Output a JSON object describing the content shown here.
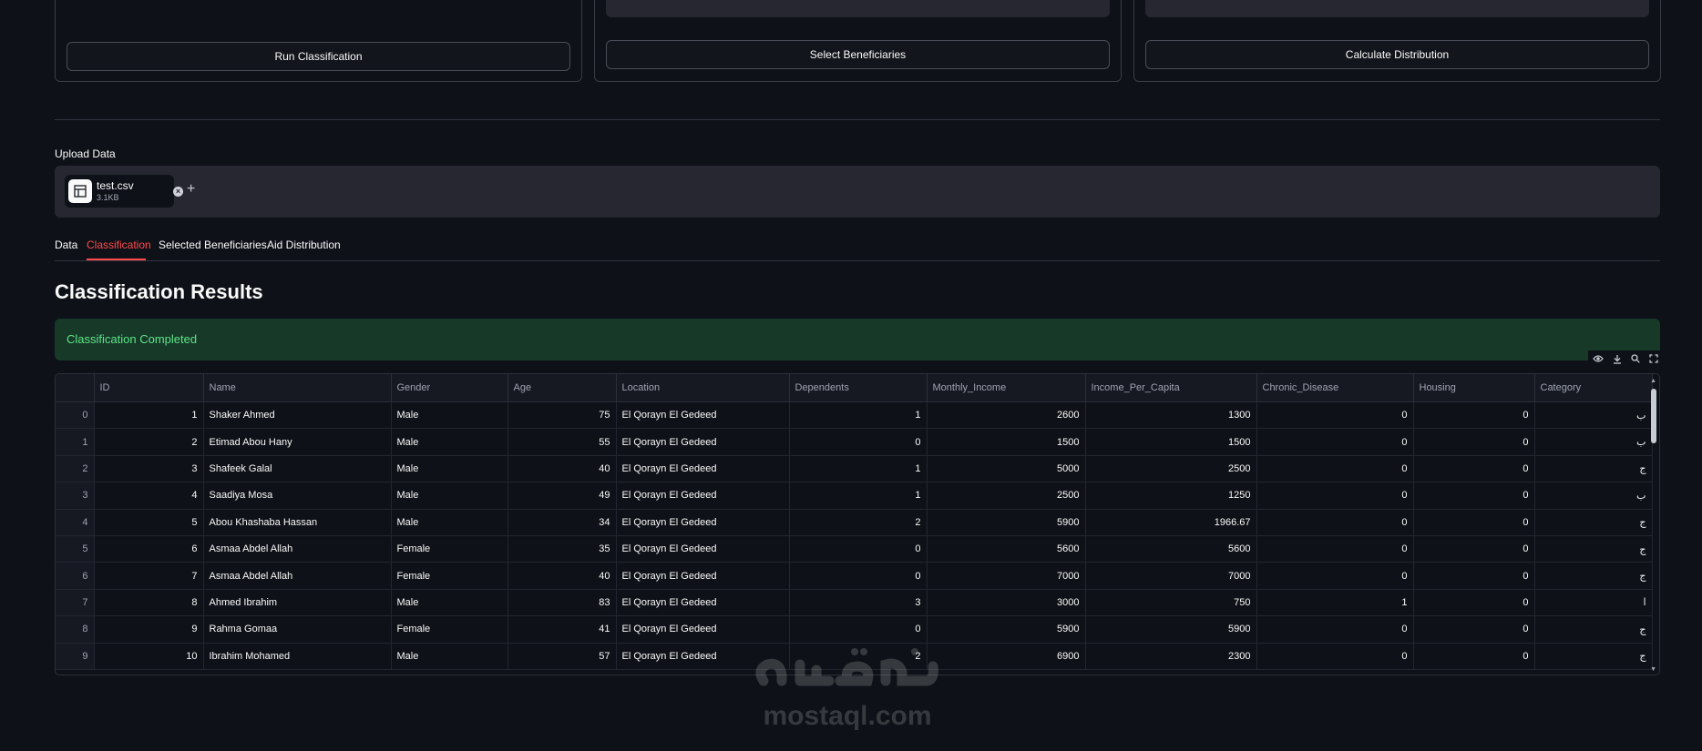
{
  "action_cards": [
    {
      "button_label": "Run Classification"
    },
    {
      "button_label": "Select Beneficiaries"
    },
    {
      "button_label": "Calculate Distribution"
    }
  ],
  "upload": {
    "label": "Upload Data",
    "file_name": "test.csv",
    "file_size": "3.1KB",
    "add_symbol": "+"
  },
  "tabs": [
    "Data",
    "Classification",
    "Selected Beneficiaries",
    "Aid Distribution"
  ],
  "active_tab": "Classification",
  "section_title": "Classification Results",
  "alert": {
    "text": "Classification Completed",
    "color": "#5ce488"
  },
  "table": {
    "columns": [
      "",
      "ID",
      "Name",
      "Gender",
      "Age",
      "Location",
      "Dependents",
      "Monthly_Income",
      "Income_Per_Capita",
      "Chronic_Disease",
      "Housing",
      "Category"
    ],
    "rows": [
      [
        "0",
        "1",
        "Shaker Ahmed",
        "Male",
        "75",
        "El Qorayn El Gedeed",
        "1",
        "2600",
        "1300",
        "0",
        "0",
        "ب"
      ],
      [
        "1",
        "2",
        "Etimad Abou Hany",
        "Male",
        "55",
        "El Qorayn El Gedeed",
        "0",
        "1500",
        "1500",
        "0",
        "0",
        "ب"
      ],
      [
        "2",
        "3",
        "Shafeek Galal",
        "Male",
        "40",
        "El Qorayn El Gedeed",
        "1",
        "5000",
        "2500",
        "0",
        "0",
        "ج"
      ],
      [
        "3",
        "4",
        "Saadiya Mosa",
        "Male",
        "49",
        "El Qorayn El Gedeed",
        "1",
        "2500",
        "1250",
        "0",
        "0",
        "ب"
      ],
      [
        "4",
        "5",
        "Abou Khashaba Hassan",
        "Male",
        "34",
        "El Qorayn El Gedeed",
        "2",
        "5900",
        "1966.67",
        "0",
        "0",
        "ج"
      ],
      [
        "5",
        "6",
        "Asmaa Abdel Allah",
        "Female",
        "35",
        "El Qorayn El Gedeed",
        "0",
        "5600",
        "5600",
        "0",
        "0",
        "ج"
      ],
      [
        "6",
        "7",
        "Asmaa Abdel Allah",
        "Female",
        "40",
        "El Qorayn El Gedeed",
        "0",
        "7000",
        "7000",
        "0",
        "0",
        "ج"
      ],
      [
        "7",
        "8",
        "Ahmed Ibrahim",
        "Male",
        "83",
        "El Qorayn El Gedeed",
        "3",
        "3000",
        "750",
        "1",
        "0",
        "ا"
      ],
      [
        "8",
        "9",
        "Rahma Gomaa",
        "Female",
        "41",
        "El Qorayn El Gedeed",
        "0",
        "5900",
        "5900",
        "0",
        "0",
        "ج"
      ],
      [
        "9",
        "10",
        "Ibrahim Mohamed",
        "Male",
        "57",
        "El Qorayn El Gedeed",
        "2",
        "6900",
        "2300",
        "0",
        "0",
        "ج"
      ]
    ]
  },
  "watermark": {
    "text": "mostaql.com",
    "arabic": "مستقل"
  },
  "icons": [
    "eye-icon",
    "download-icon",
    "search-icon",
    "fullscreen-icon",
    "table-file-icon",
    "close-icon"
  ]
}
